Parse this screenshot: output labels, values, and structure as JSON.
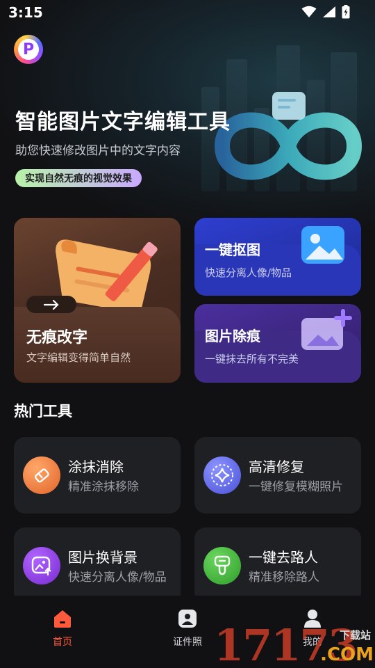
{
  "status_bar": {
    "time": "3:15"
  },
  "logo": {
    "letter": "P"
  },
  "hero": {
    "title": "智能图片文字编辑工具",
    "subtitle": "助您快速修改图片中的文字内容",
    "tag": "实现自然无痕的视觉效果"
  },
  "features": {
    "big": {
      "title": "无痕改字",
      "subtitle": "文字编辑变得简单自然"
    },
    "top_right": {
      "title": "一键抠图",
      "subtitle": "快速分离人像/物品"
    },
    "bottom_right": {
      "title": "图片除痕",
      "subtitle": "一键抹去所有不完美"
    }
  },
  "hot_tools": {
    "title": "热门工具",
    "items": [
      {
        "name": "涂抹消除",
        "desc": "精准涂抹移除",
        "icon": "eraser-icon",
        "color": "#f07a3a"
      },
      {
        "name": "高清修复",
        "desc": "一键修复模糊照片",
        "icon": "sparkle-icon",
        "color": "#5a63e6"
      },
      {
        "name": "图片换背景",
        "desc": "快速分离人像/物品",
        "icon": "image-upload-icon",
        "color": "#8a3ae0"
      },
      {
        "name": "一键去路人",
        "desc": "精准移除路人",
        "icon": "brush-icon",
        "color": "#3fb53a"
      }
    ]
  },
  "tabs": [
    {
      "label": "首页",
      "icon": "home-icon",
      "active": true
    },
    {
      "label": "证件照",
      "icon": "id-photo-icon",
      "active": false
    },
    {
      "label": "我的",
      "icon": "user-icon",
      "active": false
    }
  ],
  "watermark": {
    "number": "17173",
    "cn": "下载站",
    "domain": ".COM"
  },
  "colors": {
    "accent": "#ff5a3c",
    "background": "#111113",
    "card": "#1f2024"
  }
}
